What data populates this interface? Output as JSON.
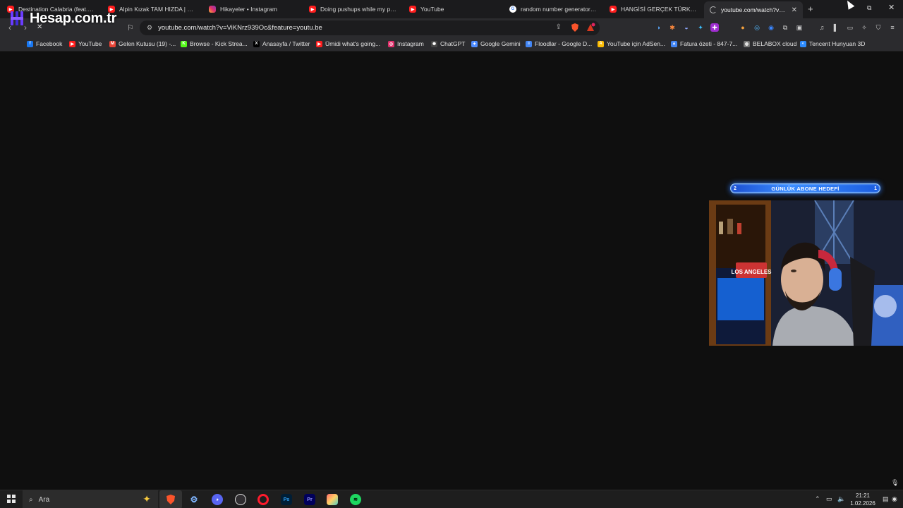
{
  "overlay": {
    "logo_text": "Hesap.com.tr"
  },
  "tabs": [
    {
      "title": "Destination Calabria (feat. Crys",
      "icon": "youtube-icon"
    },
    {
      "title": "Alpin Kızak TAM HIZDA | 4K | Ir",
      "icon": "youtube-icon"
    },
    {
      "title": "Hikayeler • Instagram",
      "icon": "instagram-icon"
    },
    {
      "title": "Doing pushups while my paren",
      "icon": "youtube-icon"
    },
    {
      "title": "YouTube",
      "icon": "youtube-icon"
    },
    {
      "title": "random number generator - G",
      "icon": "google-icon"
    },
    {
      "title": "HANGİSİ GERÇEK TÜRK VATAN",
      "icon": "youtube-icon"
    },
    {
      "title": "youtube.com/watch?v=ViK",
      "icon": "loading-icon"
    }
  ],
  "address_bar": {
    "url": "youtube.com/watch?v=ViKNrz939Oc&feature=youtu.be"
  },
  "bookmarks": [
    {
      "label": "Facebook",
      "icon": "facebook-icon",
      "color": "#1877f2"
    },
    {
      "label": "YouTube",
      "icon": "youtube-icon",
      "color": "#ff1e1e"
    },
    {
      "label": "Gelen Kutusu (19) -...",
      "icon": "gmail-icon",
      "color": "#ea4335"
    },
    {
      "label": "Browse - Kick Strea...",
      "icon": "kick-icon",
      "color": "#53fc18"
    },
    {
      "label": "Anasayfa / Twitter",
      "icon": "x-icon",
      "color": "#000000"
    },
    {
      "label": "Ümidi what's going...",
      "icon": "youtube-icon",
      "color": "#ff1e1e"
    },
    {
      "label": "Instagram",
      "icon": "instagram-icon",
      "color": "#e1306c"
    },
    {
      "label": "ChatGPT",
      "icon": "chatgpt-icon",
      "color": "#444444"
    },
    {
      "label": "Google Gemini",
      "icon": "gemini-icon",
      "color": "#4e8cff"
    },
    {
      "label": "Floodlar - Google D...",
      "icon": "google-docs-icon",
      "color": "#4285f4"
    },
    {
      "label": "YouTube için AdSen...",
      "icon": "adsense-icon",
      "color": "#fbbc04"
    },
    {
      "label": "Fatura özeti - 847-7...",
      "icon": "google-ads-icon",
      "color": "#4285f4"
    },
    {
      "label": "BELABOX cloud",
      "icon": "globe-icon",
      "color": "#777777"
    },
    {
      "label": "Tencent Hunyuan 3D",
      "icon": "hunyuan-icon",
      "color": "#2d8cff"
    }
  ],
  "stream_overlay": {
    "goal_label": "GÜNLÜK ABONE HEDEFİ",
    "current": "2",
    "target": "1"
  },
  "taskbar": {
    "search_placeholder": "Ara",
    "clock_time": "21:21",
    "clock_date": "1.02.2026",
    "apps": [
      "brave-icon",
      "settings-icon",
      "discord-icon",
      "obs-icon",
      "opera-icon",
      "photoshop-icon",
      "premiere-icon",
      "photos-icon",
      "spotify-icon"
    ],
    "app_labels": {
      "ps": "Ps",
      "pr": "Pr"
    }
  },
  "colors": {
    "accent_blue": "#2f7bff",
    "youtube_red": "#ff1e1e",
    "background": "#0f0f0f"
  }
}
